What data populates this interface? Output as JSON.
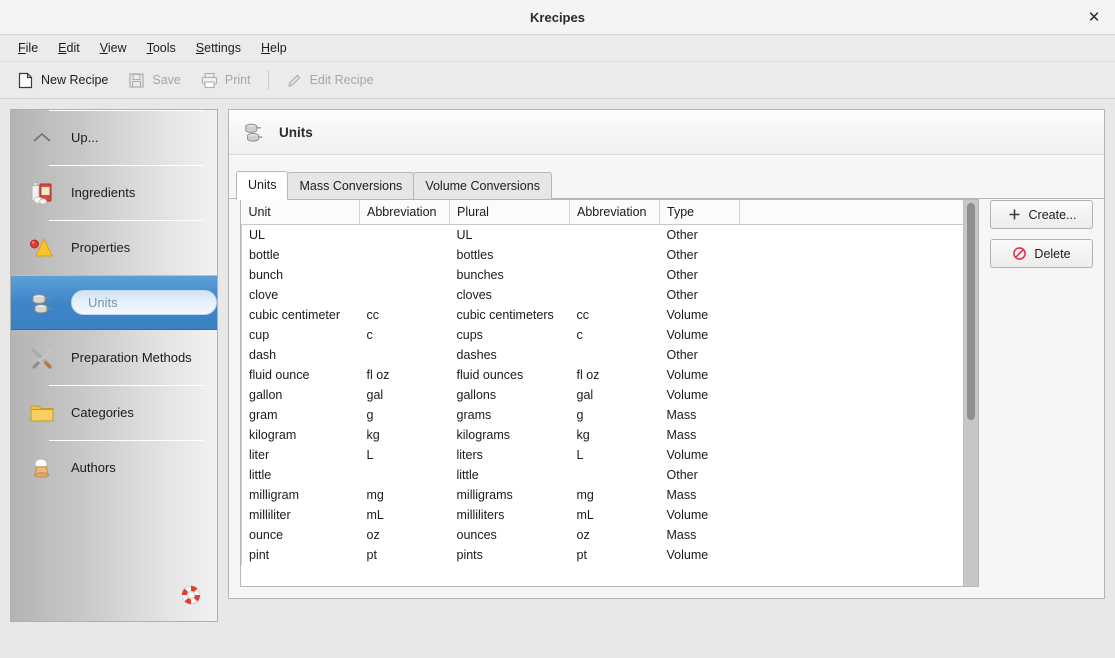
{
  "window": {
    "title": "Krecipes",
    "close_label": "✕",
    "close_icon": "close-icon"
  },
  "menubar": {
    "items": [
      {
        "label": "File",
        "accel": "F"
      },
      {
        "label": "Edit",
        "accel": "E"
      },
      {
        "label": "View",
        "accel": "V"
      },
      {
        "label": "Tools",
        "accel": "T"
      },
      {
        "label": "Settings",
        "accel": "S"
      },
      {
        "label": "Help",
        "accel": "H"
      }
    ]
  },
  "toolbar": {
    "items": [
      {
        "label": "New Recipe",
        "icon": "new-document-icon",
        "enabled": true
      },
      {
        "label": "Save",
        "icon": "floppy-disk-icon",
        "enabled": false
      },
      {
        "label": "Print",
        "icon": "printer-icon",
        "enabled": false
      },
      {
        "label": "Edit Recipe",
        "icon": "pencil-icon",
        "enabled": false
      }
    ]
  },
  "sidebar": {
    "items": [
      {
        "label": "Up...",
        "icon": "chevron-up-icon",
        "selected": false
      },
      {
        "label": "Ingredients",
        "icon": "ingredients-icon",
        "selected": false
      },
      {
        "label": "Properties",
        "icon": "properties-icon",
        "selected": false
      },
      {
        "label": "Units",
        "icon": "units-icon",
        "selected": true
      },
      {
        "label": "Preparation Methods",
        "icon": "preparation-methods-icon",
        "selected": false
      },
      {
        "label": "Categories",
        "icon": "folder-icon",
        "selected": false
      },
      {
        "label": "Authors",
        "icon": "authors-icon",
        "selected": false
      }
    ],
    "help_icon": "lifesaver-help-icon"
  },
  "content": {
    "header": {
      "title": "Units",
      "icon": "units-icon"
    },
    "tabs": [
      {
        "label": "Units",
        "active": true
      },
      {
        "label": "Mass Conversions",
        "active": false
      },
      {
        "label": "Volume Conversions",
        "active": false
      }
    ],
    "table": {
      "columns": [
        "Unit",
        "Abbreviation",
        "Plural",
        "Abbreviation",
        "Type",
        ""
      ],
      "rows": [
        [
          "UL",
          "",
          "UL",
          "",
          "Other"
        ],
        [
          "bottle",
          "",
          "bottles",
          "",
          "Other"
        ],
        [
          "bunch",
          "",
          "bunches",
          "",
          "Other"
        ],
        [
          "clove",
          "",
          "cloves",
          "",
          "Other"
        ],
        [
          "cubic centimeter",
          "cc",
          "cubic centimeters",
          "cc",
          "Volume"
        ],
        [
          "cup",
          "c",
          "cups",
          "c",
          "Volume"
        ],
        [
          "dash",
          "",
          "dashes",
          "",
          "Other"
        ],
        [
          "fluid ounce",
          "fl oz",
          "fluid ounces",
          "fl oz",
          "Volume"
        ],
        [
          "gallon",
          "gal",
          "gallons",
          "gal",
          "Volume"
        ],
        [
          "gram",
          "g",
          "grams",
          "g",
          "Mass"
        ],
        [
          "kilogram",
          "kg",
          "kilograms",
          "kg",
          "Mass"
        ],
        [
          "liter",
          "L",
          "liters",
          "L",
          "Volume"
        ],
        [
          "little",
          "",
          "little",
          "",
          "Other"
        ],
        [
          "milligram",
          "mg",
          "milligrams",
          "mg",
          "Mass"
        ],
        [
          "milliliter",
          "mL",
          "milliliters",
          "mL",
          "Volume"
        ],
        [
          "ounce",
          "oz",
          "ounces",
          "oz",
          "Mass"
        ],
        [
          "pint",
          "pt",
          "pints",
          "pt",
          "Volume"
        ]
      ],
      "scrollbar": {
        "name": "vertical-scrollbar"
      }
    },
    "actions": [
      {
        "label": "Create...",
        "icon": "plus-icon"
      },
      {
        "label": "Delete",
        "icon": "no-entry-icon"
      }
    ]
  }
}
